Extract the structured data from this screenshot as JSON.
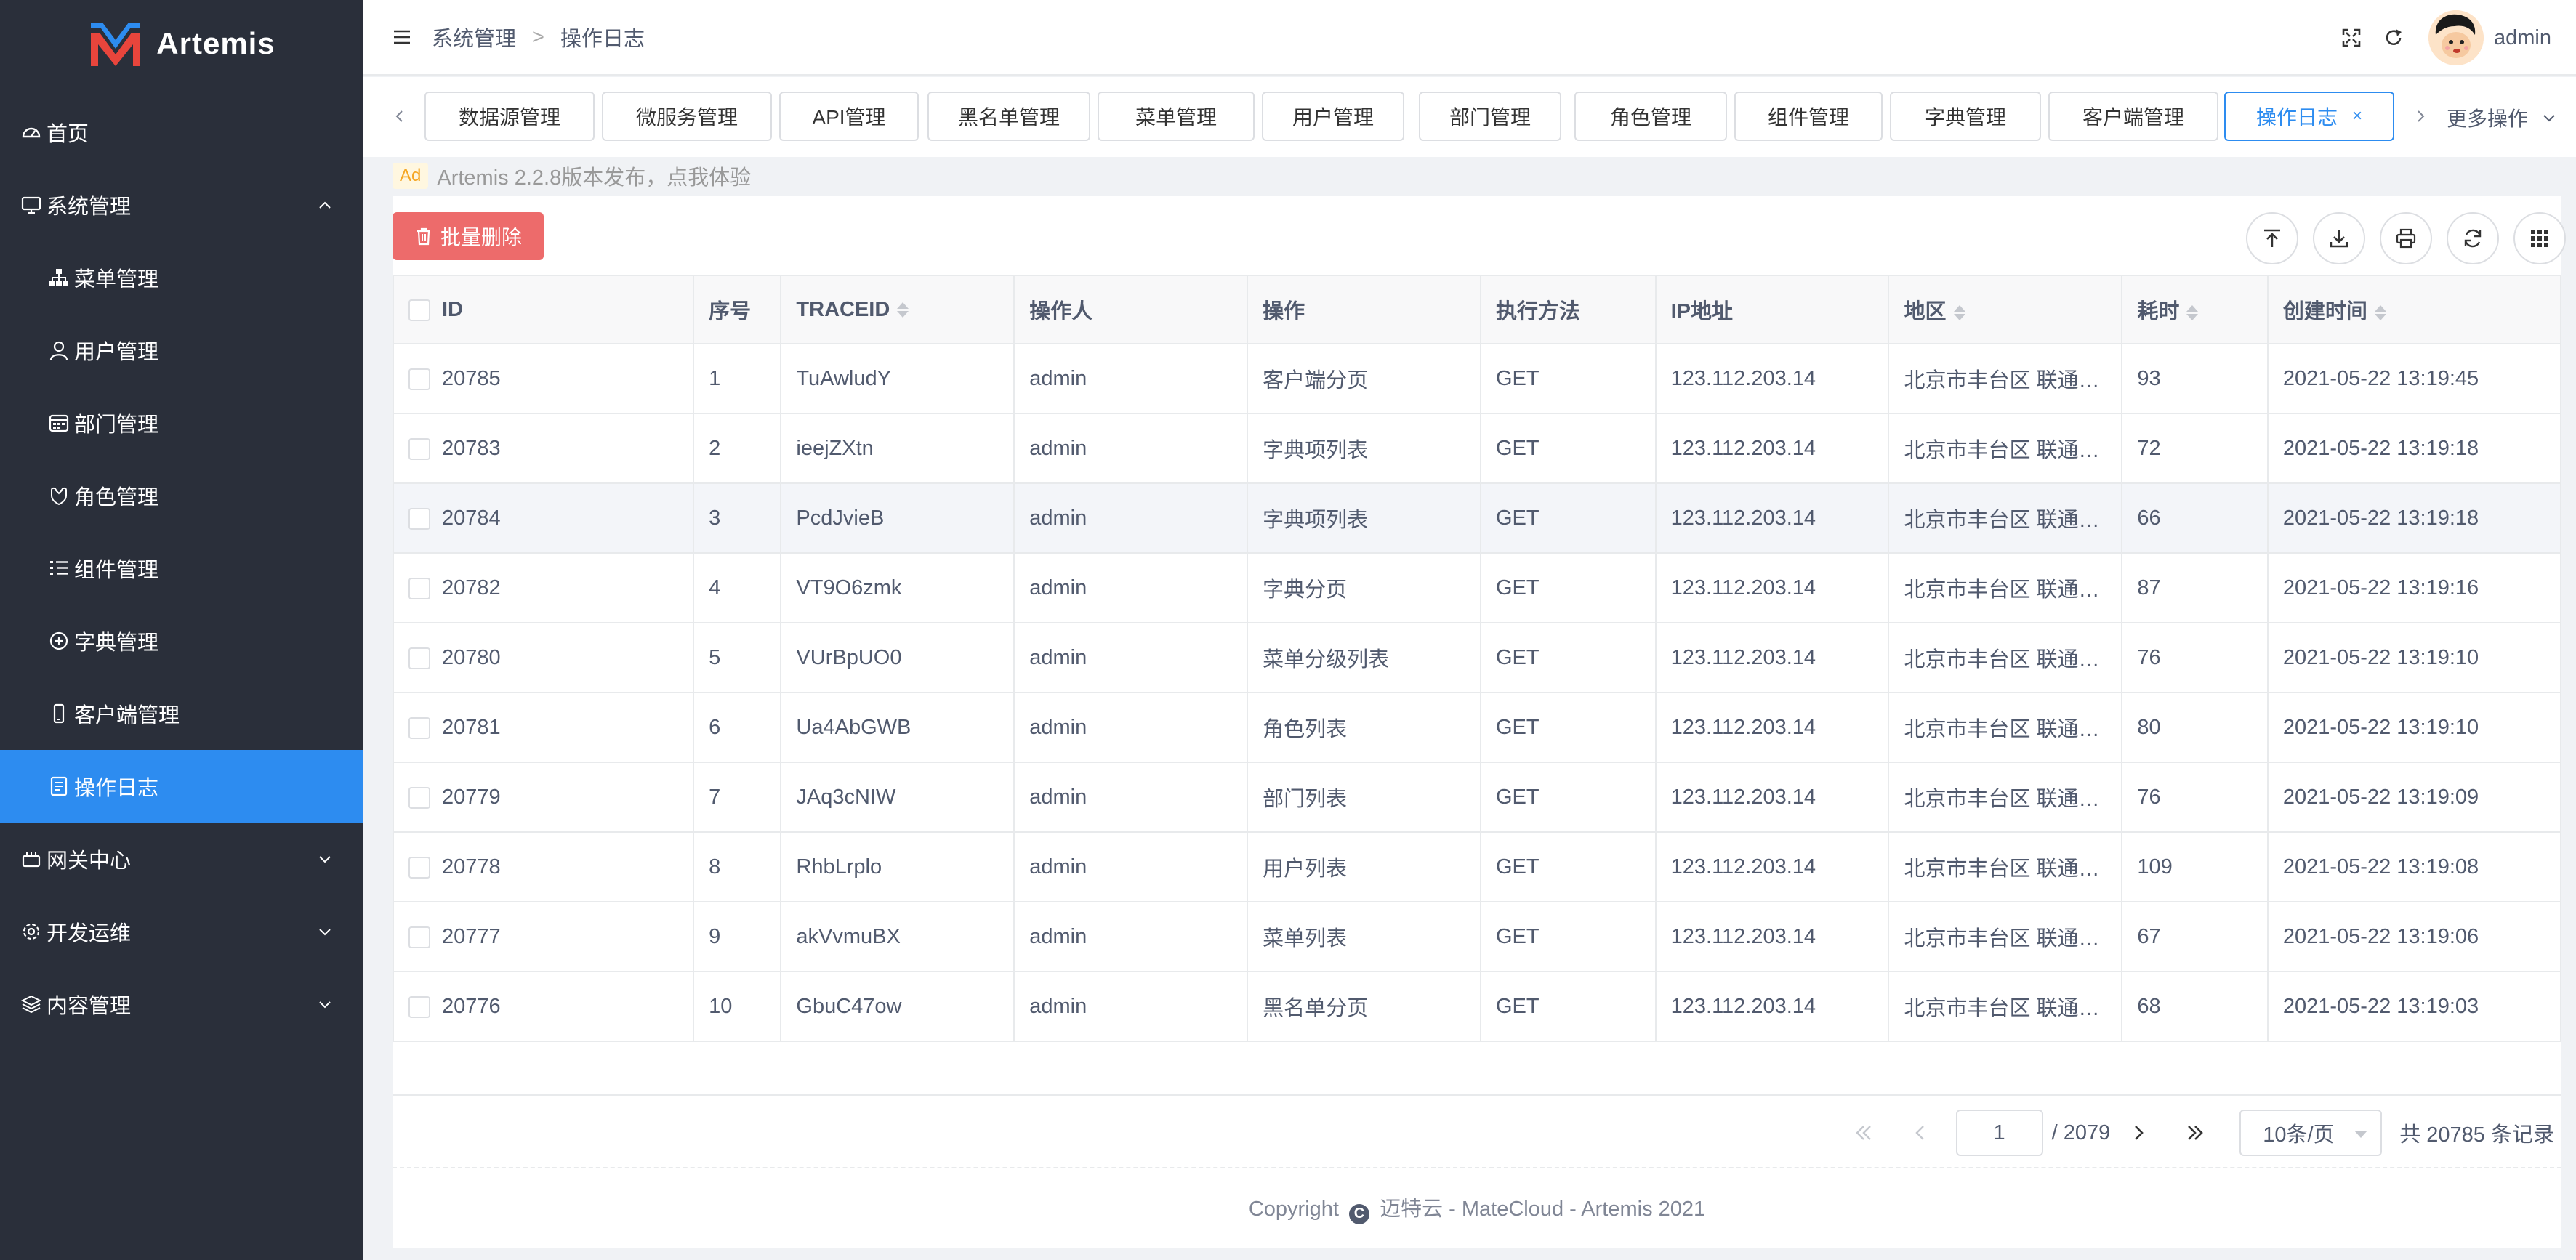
{
  "app": {
    "name": "Artemis"
  },
  "sidebar": {
    "items": [
      {
        "label": "首页",
        "icon": "dashboard-icon"
      },
      {
        "label": "系统管理",
        "icon": "monitor-icon",
        "expanded": true
      },
      {
        "label": "菜单管理",
        "icon": "sitemap-icon"
      },
      {
        "label": "用户管理",
        "icon": "user-icon"
      },
      {
        "label": "部门管理",
        "icon": "calendar-icon"
      },
      {
        "label": "角色管理",
        "icon": "role-icon"
      },
      {
        "label": "组件管理",
        "icon": "list-icon"
      },
      {
        "label": "字典管理",
        "icon": "plus-circle-icon"
      },
      {
        "label": "客户端管理",
        "icon": "mobile-icon"
      },
      {
        "label": "操作日志",
        "icon": "log-icon",
        "active": true
      },
      {
        "label": "网关中心",
        "icon": "gateway-icon"
      },
      {
        "label": "开发运维",
        "icon": "settings-icon"
      },
      {
        "label": "内容管理",
        "icon": "layers-icon"
      }
    ]
  },
  "header": {
    "breadcrumb": [
      "系统管理",
      "操作日志"
    ],
    "separator": ">",
    "username": "admin"
  },
  "tabs": {
    "items": [
      "数据源管理",
      "微服务管理",
      "API管理",
      "黑名单管理",
      "菜单管理",
      "用户管理",
      "部门管理",
      "角色管理",
      "组件管理",
      "字典管理",
      "客户端管理",
      "操作日志"
    ],
    "active_index": 11,
    "close_glyph": "×",
    "more_label": "更多操作"
  },
  "ad": {
    "badge": "Ad",
    "text": "Artemis 2.2.8版本发布，点我体验"
  },
  "toolbar": {
    "batch_delete_label": "批量删除"
  },
  "table": {
    "columns": [
      "ID",
      "序号",
      "TRACEID",
      "操作人",
      "操作",
      "执行方法",
      "IP地址",
      "地区",
      "耗时",
      "创建时间"
    ],
    "rows": [
      [
        "20785",
        "1",
        "TuAwludY",
        "admin",
        "客户端分页",
        "GET",
        "123.112.203.14",
        "北京市丰台区 联通A...",
        "93",
        "2021-05-22 13:19:45"
      ],
      [
        "20783",
        "2",
        "ieejZXtn",
        "admin",
        "字典项列表",
        "GET",
        "123.112.203.14",
        "北京市丰台区 联通A...",
        "72",
        "2021-05-22 13:19:18"
      ],
      [
        "20784",
        "3",
        "PcdJvieB",
        "admin",
        "字典项列表",
        "GET",
        "123.112.203.14",
        "北京市丰台区 联通A...",
        "66",
        "2021-05-22 13:19:18"
      ],
      [
        "20782",
        "4",
        "VT9O6zmk",
        "admin",
        "字典分页",
        "GET",
        "123.112.203.14",
        "北京市丰台区 联通A...",
        "87",
        "2021-05-22 13:19:16"
      ],
      [
        "20780",
        "5",
        "VUrBpUO0",
        "admin",
        "菜单分级列表",
        "GET",
        "123.112.203.14",
        "北京市丰台区 联通A...",
        "76",
        "2021-05-22 13:19:10"
      ],
      [
        "20781",
        "6",
        "Ua4AbGWB",
        "admin",
        "角色列表",
        "GET",
        "123.112.203.14",
        "北京市丰台区 联通A...",
        "80",
        "2021-05-22 13:19:10"
      ],
      [
        "20779",
        "7",
        "JAq3cNIW",
        "admin",
        "部门列表",
        "GET",
        "123.112.203.14",
        "北京市丰台区 联通A...",
        "76",
        "2021-05-22 13:19:09"
      ],
      [
        "20778",
        "8",
        "RhbLrplo",
        "admin",
        "用户列表",
        "GET",
        "123.112.203.14",
        "北京市丰台区 联通A...",
        "109",
        "2021-05-22 13:19:08"
      ],
      [
        "20777",
        "9",
        "akVvmuBX",
        "admin",
        "菜单列表",
        "GET",
        "123.112.203.14",
        "北京市丰台区 联通A...",
        "67",
        "2021-05-22 13:19:06"
      ],
      [
        "20776",
        "10",
        "GbuC47ow",
        "admin",
        "黑名单分页",
        "GET",
        "123.112.203.14",
        "北京市丰台区 联通A...",
        "68",
        "2021-05-22 13:19:03"
      ]
    ]
  },
  "pager": {
    "current_page": "1",
    "total_pages_text": "/ 2079",
    "page_size_label": "10条/页",
    "total_text": "共 20785 条记录"
  },
  "footer": {
    "prefix": "Copyright",
    "copyright_glyph": "C",
    "text": "迈特云 - MateCloud - Artemis 2021"
  },
  "colors": {
    "sidebar_bg": "#2a2f3a",
    "accent": "#2d8cf0",
    "danger": "#ed6b6b"
  }
}
